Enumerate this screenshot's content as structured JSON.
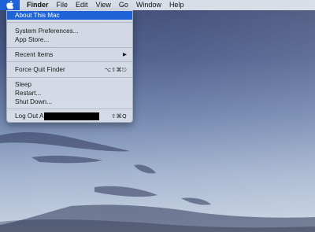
{
  "menubar": {
    "apple_icon": "apple-logo-icon",
    "items": [
      "Finder",
      "File",
      "Edit",
      "View",
      "Go",
      "Window",
      "Help"
    ]
  },
  "apple_menu": {
    "about": "About This Mac",
    "system_preferences": "System Preferences...",
    "app_store": "App Store...",
    "recent_items": "Recent Items",
    "recent_items_arrow": "▶",
    "force_quit": "Force Quit Finder",
    "force_quit_shortcut": "⌥⇧⌘⎋",
    "sleep": "Sleep",
    "restart": "Restart...",
    "shut_down": "Shut Down...",
    "log_out_prefix": "Log Out A",
    "log_out_shortcut": "⇧⌘Q"
  },
  "colors": {
    "highlight": "#1f63d8",
    "menubar": "#e2e8f0",
    "sky_top": "#3e4c77",
    "sky_bottom": "#c3cfe0"
  }
}
